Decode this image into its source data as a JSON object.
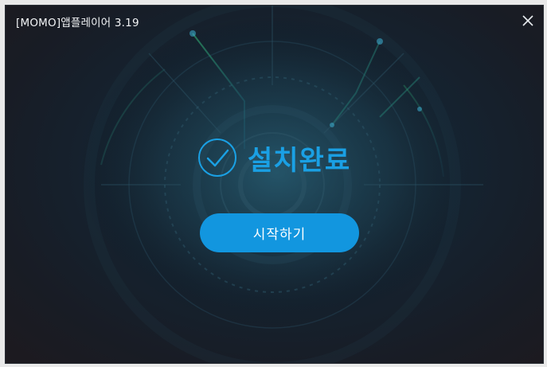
{
  "window": {
    "title": "[MOMO]앱플레이어 3.19"
  },
  "status": {
    "text": "설치완료",
    "icon": "check-circle-icon"
  },
  "actions": {
    "start_label": "시작하기"
  },
  "colors": {
    "accent": "#1aa0e4",
    "button": "#1296df",
    "background": "#172430",
    "title_text": "#f2f4f6"
  }
}
